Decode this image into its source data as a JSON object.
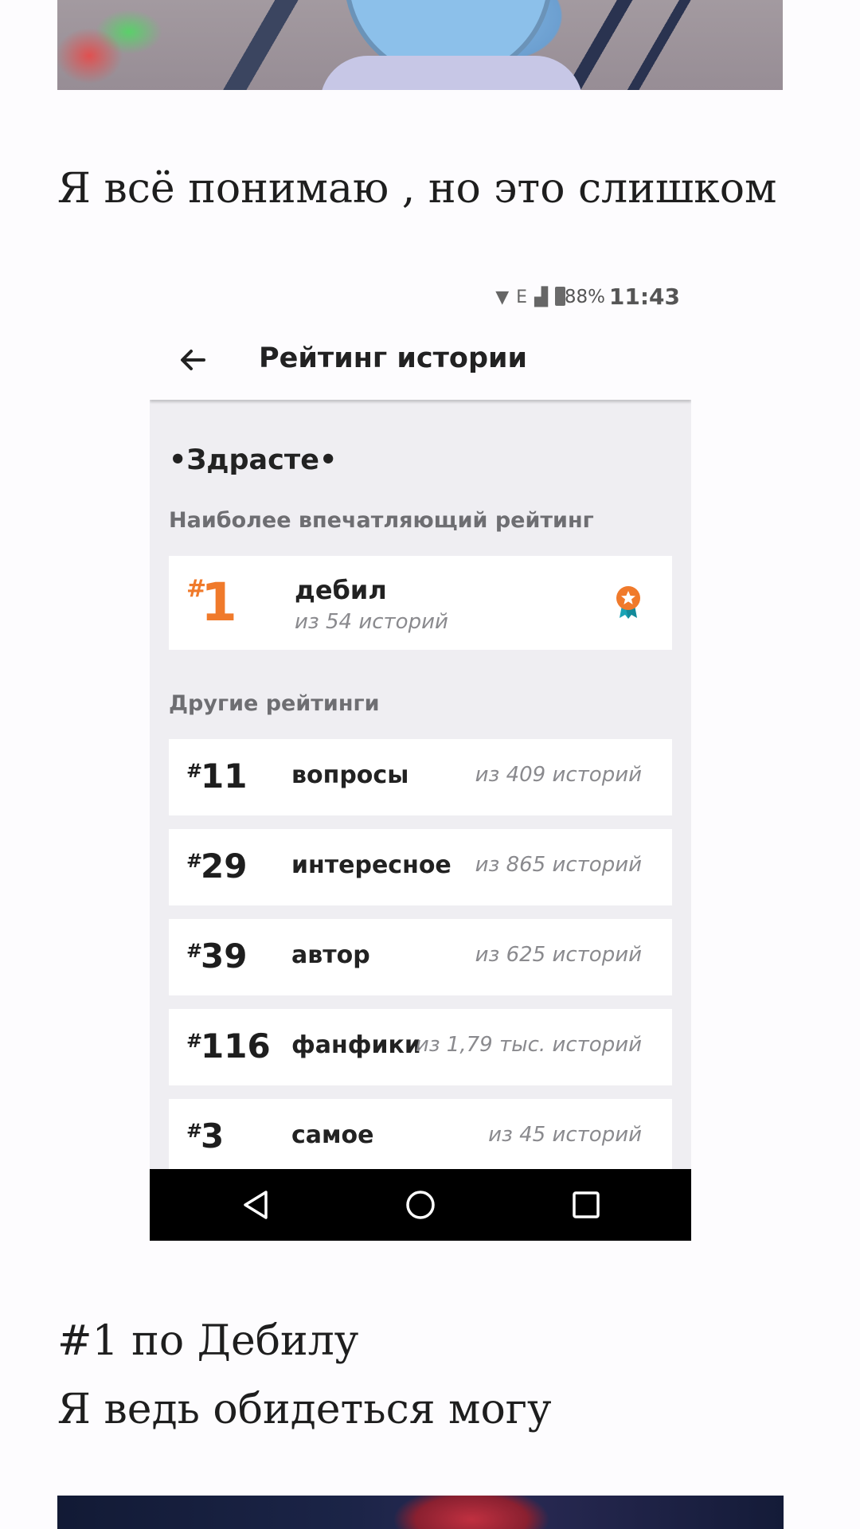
{
  "blog": {
    "caption_top": "Я всё понимаю , но это слишком",
    "caption_bottom_1": "#1 по Дебилу",
    "caption_bottom_2": "Я ведь обидеться могу"
  },
  "phone": {
    "status_bar": {
      "network": "E",
      "battery": "88%",
      "time": "11:43"
    },
    "app_bar": {
      "title": "Рейтинг истории"
    },
    "story_title": "•Здрасте•",
    "best_section_label": "Наиболее впечатляющий рейтинг",
    "best": {
      "hash": "#",
      "rank": "1",
      "category": "дебил",
      "out_of": "из 54 историй",
      "accent": "#f07a2b"
    },
    "other_section_label": "Другие рейтинги",
    "others": [
      {
        "hash": "#",
        "rank": "11",
        "category": "вопросы",
        "out_of": "из 409 историй"
      },
      {
        "hash": "#",
        "rank": "29",
        "category": "интересное",
        "out_of": "из 865 историй"
      },
      {
        "hash": "#",
        "rank": "39",
        "category": "автор",
        "out_of": "из 625 историй"
      },
      {
        "hash": "#",
        "rank": "116",
        "category": "фанфики",
        "out_of": "из 1,79 тыс. историй"
      },
      {
        "hash": "#",
        "rank": "3",
        "category": "самое",
        "out_of": "из 45 историй"
      }
    ]
  }
}
